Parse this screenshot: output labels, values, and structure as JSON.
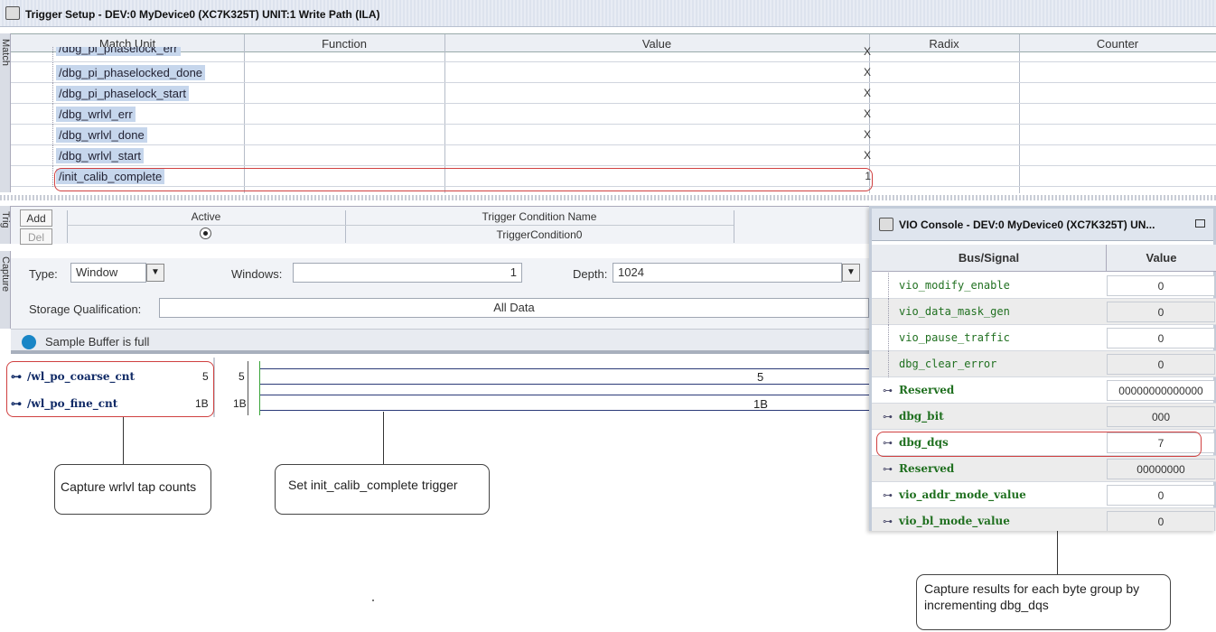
{
  "window": {
    "title": "Trigger Setup - DEV:0 MyDevice0 (XC7K325T) UNIT:1 Write Path (ILA)"
  },
  "side_tabs": {
    "match": "Match",
    "trig": "Trig",
    "capture": "Capture"
  },
  "match_table": {
    "headers": [
      "Match Unit",
      "Function",
      "Value",
      "Radix",
      "Counter"
    ],
    "rows": [
      {
        "name": "/dbg_pi_phaselock_err",
        "value": "X"
      },
      {
        "name": "/dbg_pi_phaselocked_done",
        "value": "X"
      },
      {
        "name": "/dbg_pi_phaselock_start",
        "value": "X"
      },
      {
        "name": "/dbg_wrlvl_err",
        "value": "X"
      },
      {
        "name": "/dbg_wrlvl_done",
        "value": "X"
      },
      {
        "name": "/dbg_wrlvl_start",
        "value": "X"
      },
      {
        "name": "/init_calib_complete",
        "value": "1"
      }
    ]
  },
  "trigger": {
    "add_label": "Add",
    "del_label": "Del",
    "active_header": "Active",
    "name_header": "Trigger Condition Name",
    "condition_name": "TriggerCondition0"
  },
  "capture": {
    "type_label": "Type:",
    "type_value": "Window",
    "windows_label": "Windows:",
    "windows_value": "1",
    "depth_label": "Depth:",
    "depth_value": "1024",
    "storage_label": "Storage Qualification:",
    "storage_value": "All Data"
  },
  "status": {
    "text": "Sample Buffer is full"
  },
  "waveform": {
    "signals": [
      {
        "name": "/wl_po_coarse_cnt",
        "value": "5",
        "cursor_value": "5",
        "wave_value": "5"
      },
      {
        "name": "/wl_po_fine_cnt",
        "value": "1B",
        "cursor_value": "1B",
        "wave_value": "1B"
      }
    ]
  },
  "vio": {
    "title": "VIO Console - DEV:0 MyDevice0 (XC7K325T) UN...",
    "headers": {
      "signal": "Bus/Signal",
      "value": "Value"
    },
    "rows": [
      {
        "name": "vio_modify_enable",
        "value": "0",
        "bus": false
      },
      {
        "name": "vio_data_mask_gen",
        "value": "0",
        "bus": false
      },
      {
        "name": "vio_pause_traffic",
        "value": "0",
        "bus": false
      },
      {
        "name": "dbg_clear_error",
        "value": "0",
        "bus": false
      },
      {
        "name": "Reserved",
        "value": "00000000000000",
        "bus": true
      },
      {
        "name": "dbg_bit",
        "value": "000",
        "bus": true
      },
      {
        "name": "dbg_dqs",
        "value": "7",
        "bus": true
      },
      {
        "name": "Reserved",
        "value": "00000000",
        "bus": true
      },
      {
        "name": "vio_addr_mode_value",
        "value": "0",
        "bus": true
      },
      {
        "name": "vio_bl_mode_value",
        "value": "0",
        "bus": true
      }
    ]
  },
  "callouts": {
    "wrlvl": "Capture wrlvl tap counts",
    "trigger": "Set init_calib_complete trigger",
    "dqs": "Capture results for each byte group by incrementing dbg_dqs"
  },
  "colors": {
    "highlight": "#c6d6ec",
    "annotation_red": "#d04040",
    "status_dot": "#1a86c6",
    "vio_signal": "#207020"
  }
}
